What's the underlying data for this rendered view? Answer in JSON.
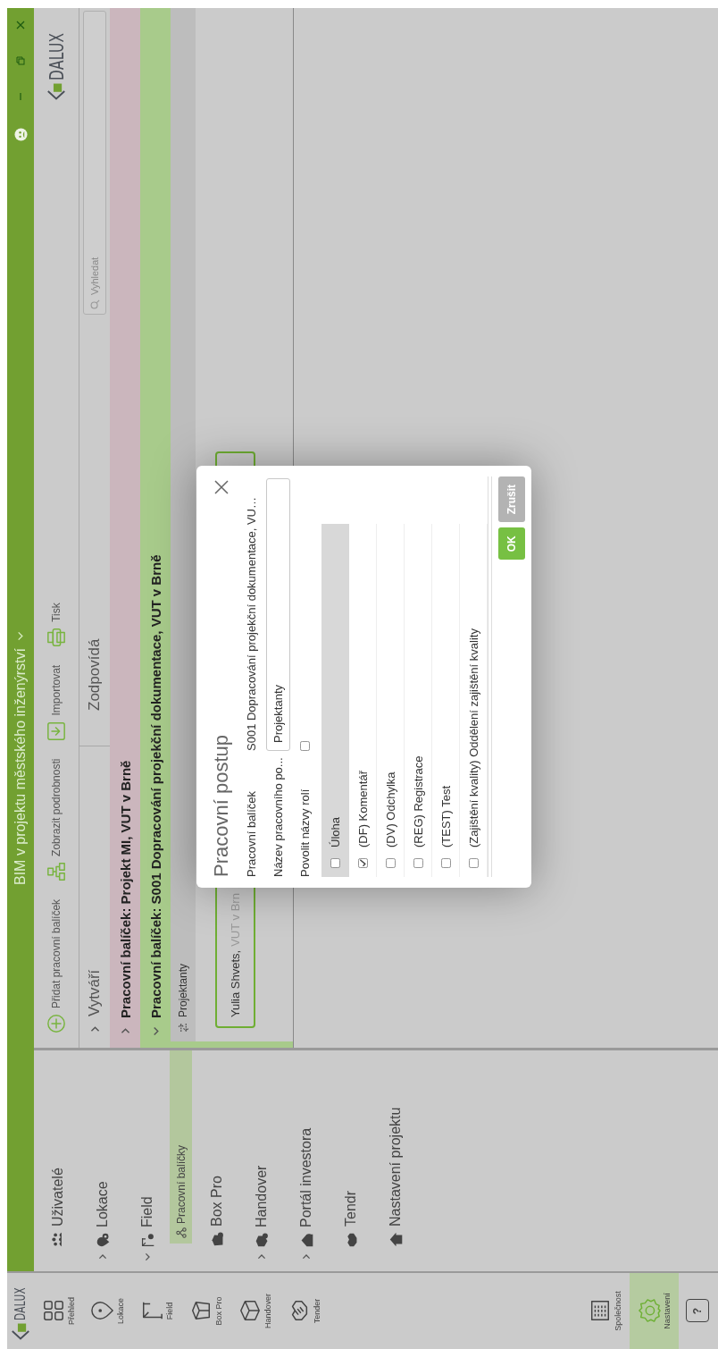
{
  "window": {
    "title": "BIM v projektu městského inženýrství"
  },
  "rail": {
    "brand": "DALUX",
    "top_items": [
      {
        "label": "Přehled",
        "selected": false
      },
      {
        "label": "Lokace",
        "selected": false
      },
      {
        "label": "Field",
        "selected": false
      },
      {
        "label": "Box Pro",
        "selected": false
      },
      {
        "label": "Handover",
        "selected": false
      },
      {
        "label": "Tender",
        "selected": false
      }
    ],
    "bottom_items": [
      {
        "label": "Společnost",
        "selected": false
      },
      {
        "label": "Nastavení",
        "selected": true
      }
    ],
    "help": "?"
  },
  "nav": {
    "items": [
      {
        "label": "Uživatelé",
        "selected": false
      },
      {
        "label": "Lokace",
        "expanded": false,
        "selected": false
      },
      {
        "label": "Field",
        "expanded": true,
        "selected": false,
        "children": [
          {
            "label": "Pracovní balíčky",
            "selected": true
          }
        ]
      },
      {
        "label": "Box Pro",
        "selected": false
      },
      {
        "label": "Handover",
        "expanded": false,
        "selected": false
      },
      {
        "label": "Portál investora",
        "expanded": false,
        "selected": false
      },
      {
        "label": "Tendr",
        "selected": false
      },
      {
        "label": "Nastavení projektu",
        "selected": false
      }
    ]
  },
  "toolbar": {
    "buttons": [
      {
        "label": "Přidat pracovní balíček"
      },
      {
        "label": "Zobrazit podrobnosti"
      },
      {
        "label": "Importovat"
      },
      {
        "label": "Tisk"
      }
    ],
    "brand": "DALUX"
  },
  "table": {
    "columns": [
      {
        "label": "Vytváří",
        "expanded": false
      },
      {
        "label": "Zodpovídá"
      }
    ],
    "search": {
      "placeholder": "Vyhledat"
    },
    "groups": [
      {
        "label": "Pracovní balíček: Projekt MI, VUT v Brně",
        "expanded": false,
        "color": "#cbb6bd"
      },
      {
        "label": "Pracovní balíček: S001 Dopracování projekční dokumentace, VUT v Brně",
        "expanded": true,
        "color": "#a8cb8b",
        "roles": [
          {
            "label": "Projektanty",
            "cards": [
              {
                "name": "Yulia Shvets,",
                "company": "VUT v Brn"
              }
            ]
          }
        ]
      }
    ]
  },
  "dialog": {
    "title": "Pracovní postup",
    "fields": [
      {
        "kind": "text",
        "label": "Pracovní balíček",
        "value": "S001 Dopracování projekční dokumentace, VU…"
      },
      {
        "kind": "input",
        "label": "Název pracovního po...",
        "value": "Projektanty"
      },
      {
        "kind": "checkbox",
        "label": "Povolit názvy rolí",
        "checked": false
      }
    ],
    "table": {
      "header": "Úloha",
      "header_checked": false,
      "rows": [
        {
          "label": "(DF) Komentář",
          "checked": true
        },
        {
          "label": "(DV) Odchylka",
          "checked": false
        },
        {
          "label": "(REG) Registrace",
          "checked": false
        },
        {
          "label": "(TEST) Test",
          "checked": false
        },
        {
          "label": "(Zajištění kvality) Oddělení zajištění kvality",
          "checked": false
        }
      ]
    },
    "buttons": [
      {
        "label": "OK",
        "kind": "primary"
      },
      {
        "label": "Zrušit",
        "kind": "secondary"
      }
    ]
  }
}
